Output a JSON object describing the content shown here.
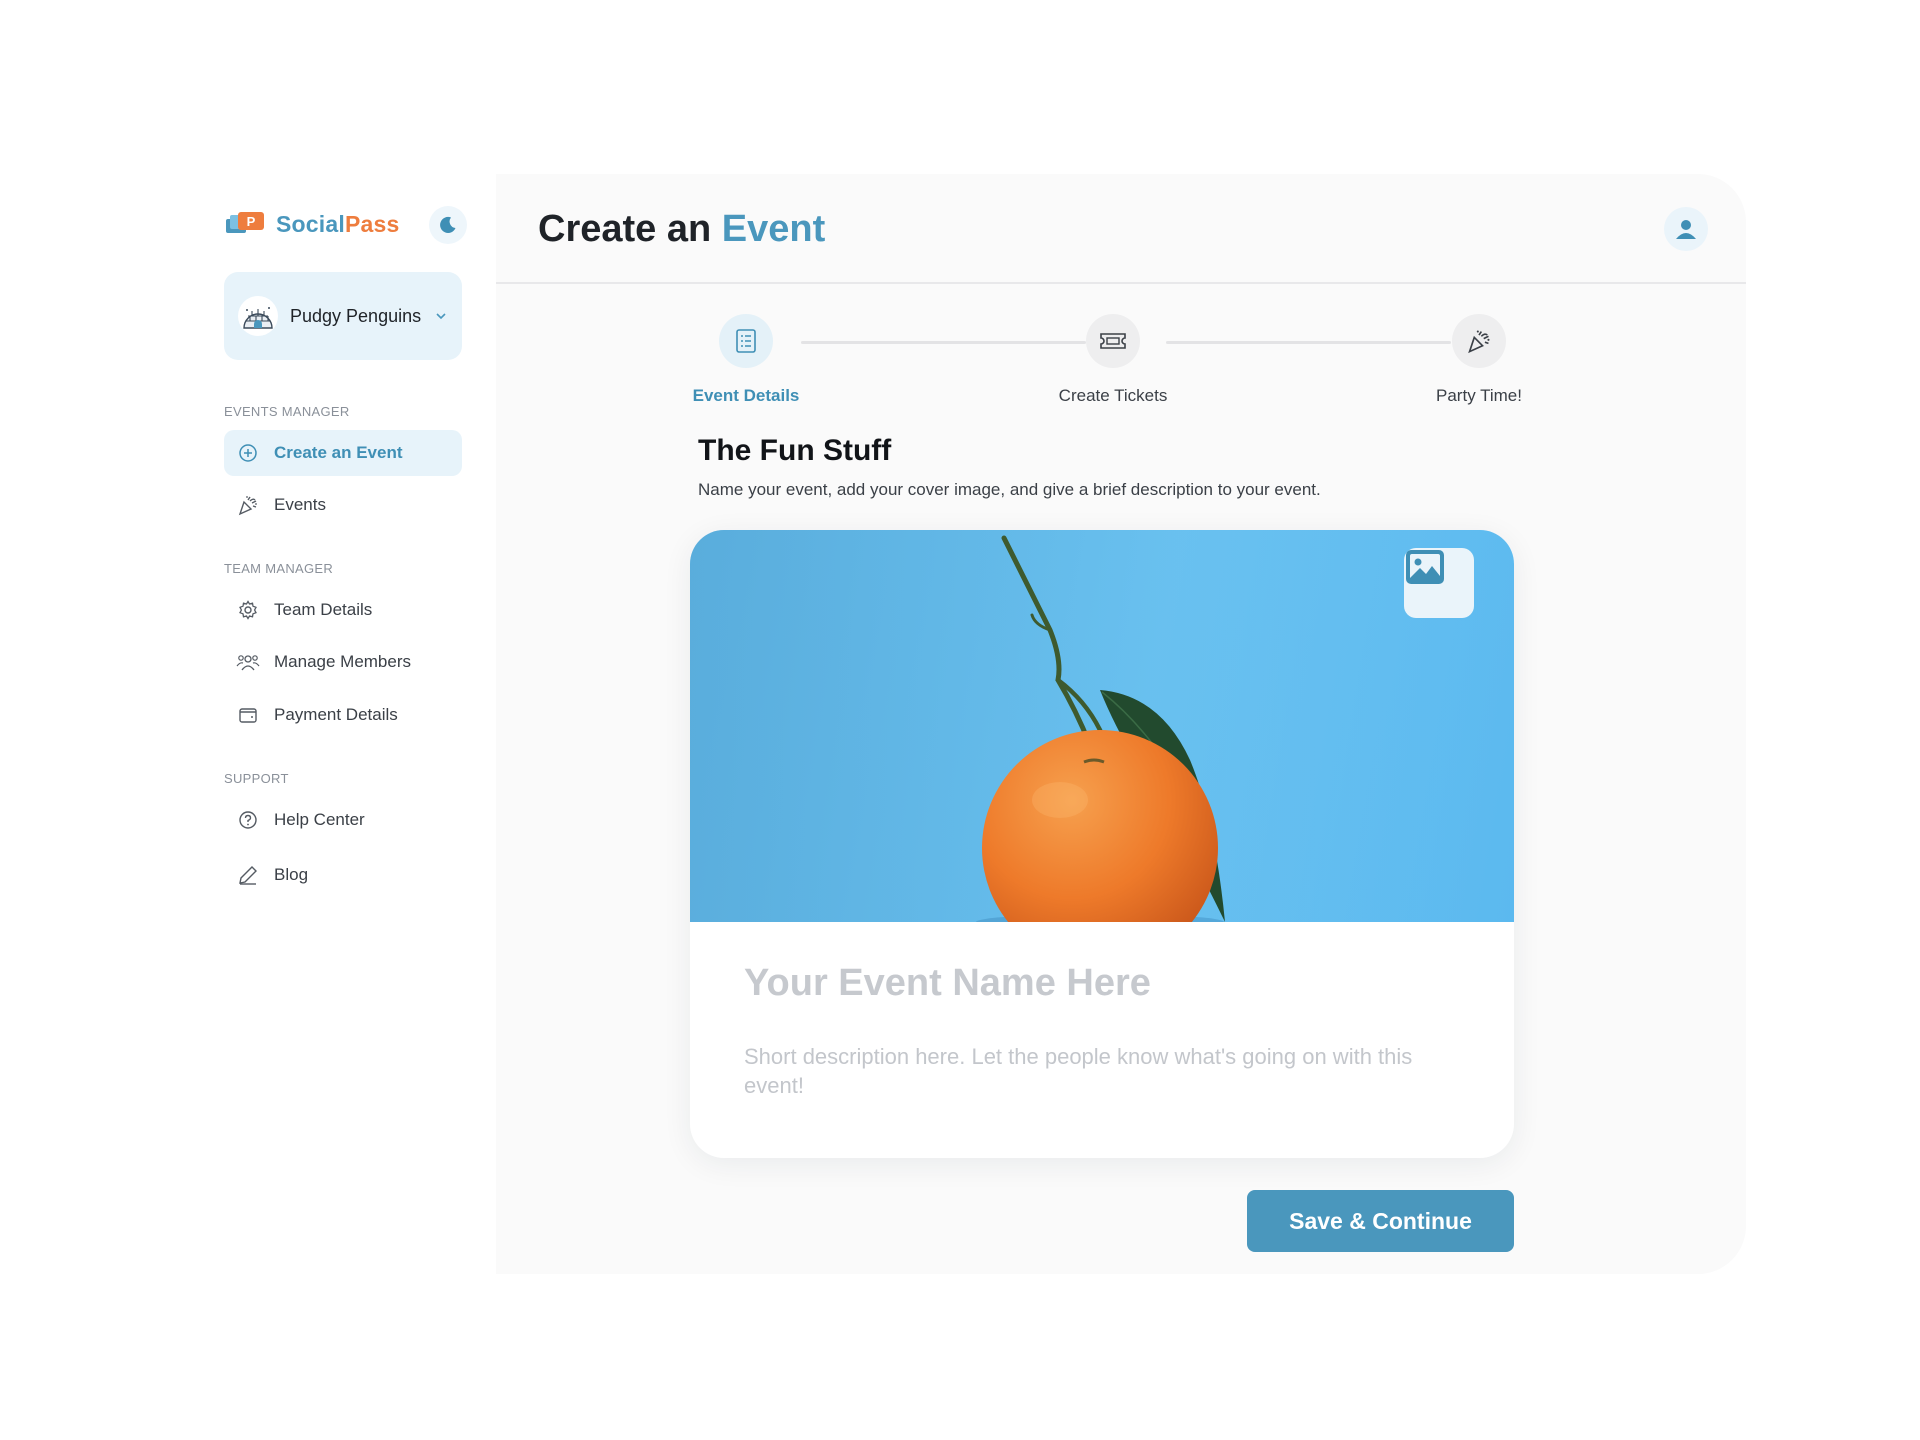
{
  "brand": {
    "name_part1": "Social",
    "name_part2": "Pass"
  },
  "team": {
    "name": "Pudgy Penguins"
  },
  "sidebar": {
    "sections": [
      {
        "label": "EVENTS MANAGER",
        "items": [
          {
            "label": "Create an Event",
            "icon": "plus-circle-icon",
            "active": true
          },
          {
            "label": "Events",
            "icon": "party-popper-icon"
          }
        ]
      },
      {
        "label": "TEAM MANAGER",
        "items": [
          {
            "label": "Team Details",
            "icon": "gear-icon"
          },
          {
            "label": "Manage Members",
            "icon": "users-icon"
          },
          {
            "label": "Payment Details",
            "icon": "wallet-icon"
          }
        ]
      },
      {
        "label": "SUPPORT",
        "items": [
          {
            "label": "Help Center",
            "icon": "help-circle-icon"
          },
          {
            "label": "Blog",
            "icon": "pencil-icon"
          }
        ]
      }
    ]
  },
  "header": {
    "title_part1": "Create an ",
    "title_part2": "Event"
  },
  "stepper": {
    "steps": [
      {
        "label": "Event Details",
        "icon": "checklist-icon",
        "active": true
      },
      {
        "label": "Create Tickets",
        "icon": "ticket-icon"
      },
      {
        "label": "Party Time!",
        "icon": "party-popper-icon"
      }
    ]
  },
  "form": {
    "section_title": "The Fun Stuff",
    "section_desc": "Name your event, add your cover image, and give a brief description to your event.",
    "event_name": {
      "value": "",
      "placeholder": "Your Event Name Here"
    },
    "event_desc": {
      "value": "",
      "placeholder": "Short description here. Let the people know what's going on with this event!"
    },
    "save_label": "Save & Continue"
  },
  "colors": {
    "accent": "#4a97bd",
    "brand_orange": "#ee7d3e",
    "active_bg": "#e7f3fa"
  }
}
